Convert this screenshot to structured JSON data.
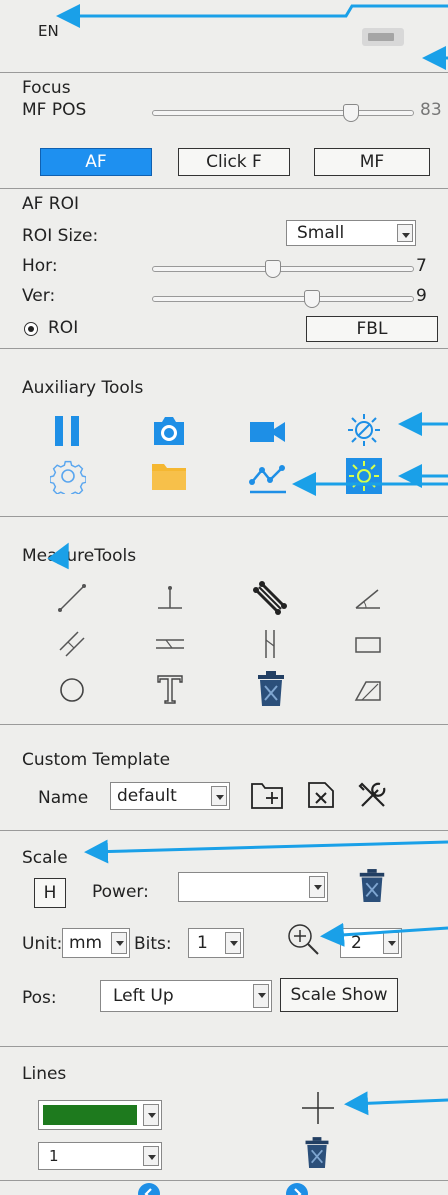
{
  "header": {
    "language": "EN",
    "badge_text": ""
  },
  "focus": {
    "title": "Focus",
    "mf_pos_label": "MF POS",
    "mf_pos_value": "83",
    "mf_pos_fraction": 0.78,
    "buttons": {
      "af": "AF",
      "click_f": "Click F",
      "mf": "MF"
    },
    "active_button": "AF"
  },
  "af_roi": {
    "title": "AF ROI",
    "roi_size_label": "ROI Size:",
    "roi_size_value": "Small",
    "hor_label": "Hor:",
    "hor_value": "7",
    "hor_fraction": 0.46,
    "ver_label": "Ver:",
    "ver_value": "9",
    "ver_fraction": 0.62,
    "radio_label": "ROI",
    "fbl_button": "FBL"
  },
  "auxiliary": {
    "title": "Auxiliary Tools",
    "icons": [
      "pause-icon",
      "camera-icon",
      "video-icon",
      "exposure-icon",
      "settings-icon",
      "folder-icon",
      "curve-icon",
      "white-balance-icon"
    ]
  },
  "measure": {
    "title": "MeasureTools",
    "icons": [
      "line-icon",
      "perpendicular-icon",
      "parallel-line-icon",
      "angle-icon",
      "two-parallel-icon",
      "horizontal-parallel-icon",
      "vertical-parallel-icon",
      "rectangle-icon",
      "circle-icon",
      "text-icon",
      "trash-icon",
      "polygon-icon"
    ]
  },
  "template": {
    "title": "Custom Template",
    "name_label": "Name",
    "name_value": "default"
  },
  "scale": {
    "title": "Scale",
    "h_button": "H",
    "power_label": "Power:",
    "power_value": "",
    "unit_label": "Unit:",
    "unit_value": "mm",
    "bits_label": "Bits:",
    "bits_value": "1",
    "zoom_value": "2",
    "pos_label": "Pos:",
    "pos_value": "Left Up",
    "scale_show_button": "Scale Show"
  },
  "lines": {
    "title": "Lines",
    "color": "#1e7a1e",
    "width_value": "1"
  },
  "colors": {
    "accent_blue": "#1e8fe6",
    "annotation_blue": "#1aa0e8",
    "folder_yellow": "#f5b731",
    "active_button_bg": "#1e90f0"
  }
}
